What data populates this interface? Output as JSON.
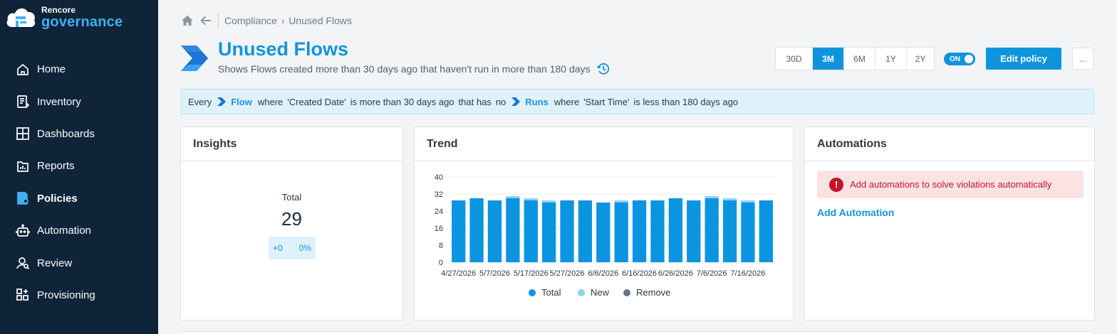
{
  "sidebar": {
    "brand": "Rencore",
    "product": "governance",
    "items": [
      {
        "label": "Home",
        "icon": "home-icon"
      },
      {
        "label": "Inventory",
        "icon": "inventory-icon"
      },
      {
        "label": "Dashboards",
        "icon": "dashboards-icon"
      },
      {
        "label": "Reports",
        "icon": "reports-icon"
      },
      {
        "label": "Policies",
        "icon": "policies-icon",
        "active": true
      },
      {
        "label": "Automation",
        "icon": "automation-icon"
      },
      {
        "label": "Review",
        "icon": "review-icon"
      },
      {
        "label": "Provisioning",
        "icon": "provisioning-icon"
      }
    ]
  },
  "breadcrumb": {
    "parent": "Compliance",
    "current": "Unused Flows"
  },
  "header": {
    "title": "Unused Flows",
    "subtitle": "Shows Flows created more than 30 days ago that haven't run in more than 180 days",
    "ranges": [
      "30D",
      "3M",
      "6M",
      "1Y",
      "2Y"
    ],
    "active_range": "3M",
    "toggle_label": "ON",
    "edit_label": "Edit policy",
    "more_label": "..."
  },
  "query": {
    "every": "Every",
    "entity1": "Flow",
    "where1": "where",
    "field1": "'Created Date'",
    "cond1": "is more than 30 days ago",
    "that_has": "that has",
    "no": "no",
    "entity2": "Runs",
    "where2": "where",
    "field2": "'Start Time'",
    "cond2": "is less than 180 days ago"
  },
  "insights": {
    "title": "Insights",
    "total_label": "Total",
    "total_value": "29",
    "delta_abs": "+0",
    "delta_pct": "0%"
  },
  "trend": {
    "title": "Trend"
  },
  "automations": {
    "title": "Automations",
    "alert": "Add automations to solve violations automatically",
    "add_link": "Add Automation"
  },
  "colors": {
    "accent": "#0f94dc",
    "sidebar_bg": "#0f2438",
    "total": "#0b95e0",
    "new": "#8fd0f3",
    "remove": "#637584",
    "alert": "#c4142b"
  },
  "chart_data": {
    "type": "bar",
    "stacked": true,
    "title": "Trend",
    "ylim": [
      0,
      40
    ],
    "yticks": [
      0,
      8,
      16,
      24,
      32,
      40
    ],
    "xtick_labels": [
      "4/27/2026",
      "5/7/2026",
      "5/17/2026",
      "5/27/2026",
      "6/6/2026",
      "6/16/2026",
      "6/26/2026",
      "7/6/2026",
      "7/16/2026"
    ],
    "categories": [
      "4/27/2026",
      "5/2/2026",
      "5/7/2026",
      "5/12/2026",
      "5/17/2026",
      "5/22/2026",
      "5/27/2026",
      "6/1/2026",
      "6/6/2026",
      "6/11/2026",
      "6/16/2026",
      "6/21/2026",
      "6/26/2026",
      "7/1/2026",
      "7/6/2026",
      "7/11/2026",
      "7/16/2026",
      "7/21/2026"
    ],
    "series": [
      {
        "name": "Total",
        "values": [
          29,
          30,
          29,
          30,
          29,
          28,
          29,
          29,
          28,
          28,
          29,
          29,
          30,
          29,
          30,
          29,
          28,
          29
        ]
      },
      {
        "name": "New",
        "values": [
          0,
          0,
          0,
          1,
          1,
          1,
          0,
          0,
          0,
          1,
          0,
          0,
          0,
          0,
          1,
          1,
          1,
          0
        ]
      },
      {
        "name": "Remove",
        "values": [
          0,
          0,
          0,
          0,
          0,
          0,
          0,
          0,
          0,
          0,
          0,
          0,
          0,
          0,
          0,
          0,
          0,
          0
        ]
      }
    ],
    "legend": [
      "Total",
      "New",
      "Remove"
    ],
    "legend_position": "bottom",
    "grid": true
  }
}
